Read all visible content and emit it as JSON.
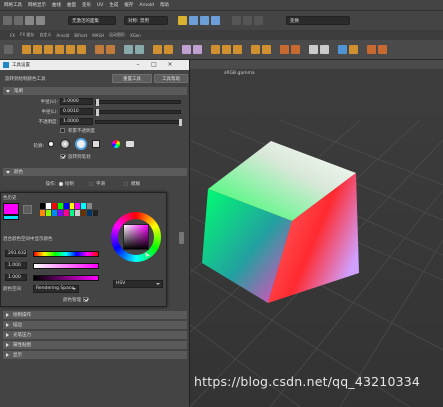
{
  "menubar": [
    "网格工具",
    "网格显示",
    "曲线",
    "曲面",
    "变形",
    "UV",
    "生成",
    "缓存",
    "Arnold",
    "帮助"
  ],
  "statusline": {
    "workspace": "无激活的面集",
    "frame": "对称: 禁用",
    "render_mode": "变换"
  },
  "shelf_tabs": [
    "FX",
    "FX 缓存",
    "自定义",
    "Arnold",
    "Bifrost",
    "MASH",
    "运动图形",
    "XGen"
  ],
  "viewport": {
    "gamma_label": "sRGB gamma"
  },
  "dialog": {
    "title": "工具设置",
    "tool_name": "旋转到绘制颜色工具",
    "reset_button": "重置工具",
    "help_button": "工具帮助",
    "sections": {
      "brush": "笔刷",
      "color": "颜色",
      "paint_ops": "绘制操作",
      "stroke": "描边",
      "stylus": "光笔压力",
      "attr_maps": "属性贴图",
      "display": "显示"
    },
    "radius_u_label": "半径(U):",
    "radius_u_value": "2.0000",
    "radius_l_label": "半径(L):",
    "radius_l_value": "0.0010",
    "opacity_label": "不透明度:",
    "opacity_value": "1.0000",
    "accumulate_label": "积累不透明度",
    "profile_label": "轮廓:",
    "rotate_stroke_label": "旋转到笔划",
    "operation_label": "操作:",
    "op_paint": "绘制",
    "op_smooth": "平滑",
    "op_blur": "模糊"
  },
  "picker": {
    "history_label": "色历史",
    "mix_label": "混合颜色空间中显示颜色",
    "hue_value": "291.632",
    "sat_value": "1.000",
    "val_value": "1.000",
    "color_space_label": "颜色空间",
    "color_space_value": "Rendering Space",
    "color_managed_label": "颜色管理",
    "mode_value": "HSV",
    "history_colors": [
      "#000000",
      "#ffffff",
      "#ff0000",
      "#00ff00",
      "#0000ff",
      "#ffff00",
      "#ff00ff",
      "#00ffff",
      "#888888",
      "#444444",
      "#ff8800",
      "#88ff00",
      "#0088ff",
      "#8800ff",
      "#ff0088",
      "#00ff88",
      "#cccccc",
      "#663300",
      "#003366",
      "#222222"
    ]
  },
  "watermark": "https://blog.csdn.net/qq_43210334"
}
